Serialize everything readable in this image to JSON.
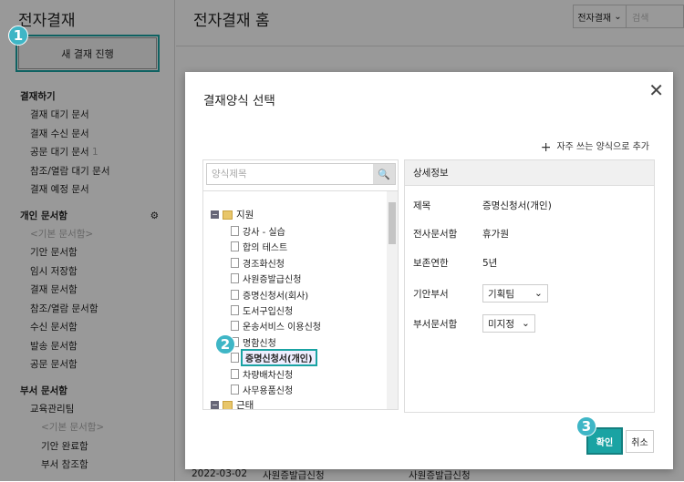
{
  "sidebar": {
    "title": "전자결재",
    "new_button": "새 결재 진행",
    "sections": [
      {
        "label": "결재하기",
        "items": [
          "결재 대기 문서",
          "결재 수신 문서",
          "공문 대기 문서",
          "참조/열람 대기 문서",
          "결재 예정 문서"
        ],
        "badge": "1"
      },
      {
        "label": "개인 문서함",
        "subheader": "<기본 문서함>",
        "items": [
          "기안 문서함",
          "임시 저장함",
          "결재 문서함",
          "참조/열람 문서함",
          "수신 문서함",
          "발송 문서함",
          "공문 문서함"
        ]
      },
      {
        "label": "부서 문서함",
        "team": "교육관리팀",
        "subheader": "<기본 문서함>",
        "items": [
          "기안 완료함",
          "부서 참조함"
        ]
      }
    ]
  },
  "main": {
    "title": "전자결재 홈",
    "search_scope": "전자결재",
    "search_placeholder": "검색",
    "bottom_row": [
      "2022-03-02",
      "사원증발급신청",
      "사원증발급신청"
    ]
  },
  "badges": [
    "1",
    "2",
    "3"
  ],
  "modal": {
    "title": "결재양식 선택",
    "add_favorite": "자주 쓰는 양식으로 추가",
    "tree": {
      "search_placeholder": "양식제목",
      "folders": [
        {
          "label": "지원",
          "items": [
            "강사 - 실습",
            "합의 테스트",
            "경조화신청",
            "사원증발급신청",
            "증명신청서(회사)",
            "도서구입신청",
            "운송서비스 이용신청",
            "명함신청",
            "증명신청서(개인)",
            "차량배차신청",
            "사무용품신청"
          ]
        },
        {
          "label": "근태"
        }
      ],
      "selected": "증명신청서(개인)"
    },
    "detail": {
      "header": "상세정보",
      "rows": [
        {
          "label": "제목",
          "value": "증명신청서(개인)"
        },
        {
          "label": "전사문서함",
          "value": "휴가원"
        },
        {
          "label": "보존연한",
          "value": "5년"
        },
        {
          "label": "기안부서",
          "value": "기획팀"
        },
        {
          "label": "부서문서함",
          "value": "미지정"
        }
      ]
    },
    "confirm": "확인",
    "cancel": "취소"
  },
  "colors": {
    "accent": "#1aa3a3",
    "badge": "#3fb6c6"
  }
}
